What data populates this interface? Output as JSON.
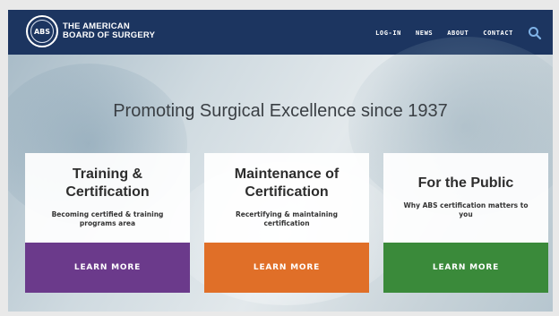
{
  "header": {
    "logo_mark": "ABS",
    "logo_line1": "THE AMERICAN",
    "logo_line2": "BOARD OF SURGERY",
    "nav": [
      "LOG-IN",
      "NEWS",
      "ABOUT",
      "CONTACT"
    ],
    "search_icon": "search-icon"
  },
  "hero": {
    "tagline": "Promoting Surgical Excellence since 1937"
  },
  "cards": [
    {
      "title_line1": "Training &",
      "title_line2": "Certification",
      "desc_line1": "Becoming certified & training",
      "desc_line2": "programs area",
      "button": "LEARN MORE",
      "color": "#6b3a8b"
    },
    {
      "title_line1": "Maintenance of",
      "title_line2": "Certification",
      "desc_line1": "Recertifying & maintaining",
      "desc_line2": "certification",
      "button": "LEARN MORE",
      "color": "#e06f28"
    },
    {
      "title_line1": "For the Public",
      "desc_line1": "Why ABS certification matters to",
      "desc_line2": "you",
      "button": "LEARN MORE",
      "color": "#3a8a3a"
    }
  ],
  "colors": {
    "header_bg": "#1c3560",
    "page_bg": "#e9e9e9"
  }
}
